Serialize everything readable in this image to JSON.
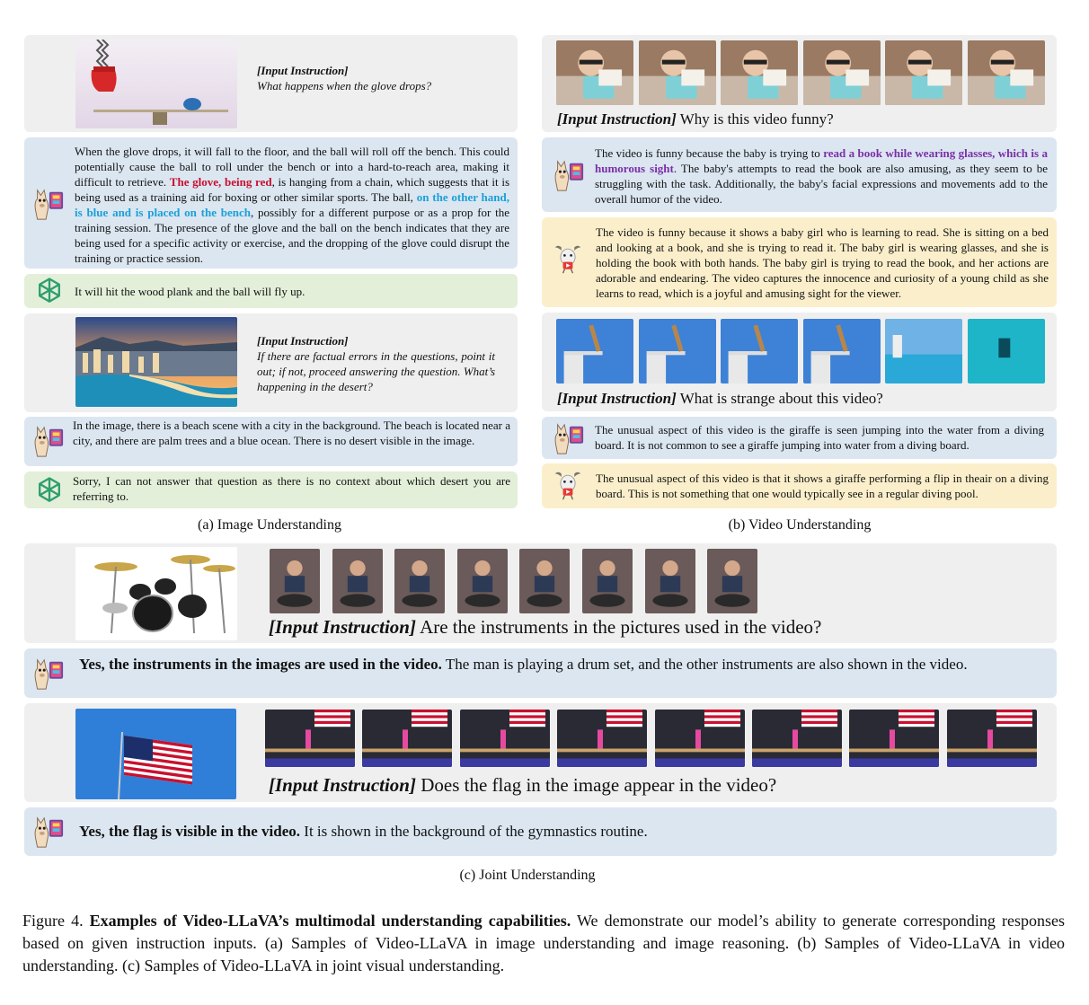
{
  "a": {
    "q1": {
      "label": "[Input Instruction]",
      "text": "What happens when the glove drops?"
    },
    "a1_llava": {
      "p1": "When the glove drops, it will fall to the floor, and the ball will roll off the bench. This could potentially cause the ball to roll under the bench or into a hard-to-reach area, making it difficult to retrieve. ",
      "h1": "The glove, being red",
      "p2": ", is hanging from a chain, which suggests that it is being used as a training aid for boxing or other similar sports. The ball, ",
      "h2": "on the other hand, is blue and is placed on the bench",
      "p3": ", possibly for a different purpose or as a prop for the training session. The presence of the glove and the ball on the bench indicates that they are being used for a specific activity or exercise, and the dropping of the glove could disrupt the training or practice session."
    },
    "a1_gpt": "It will hit the wood plank and the ball will fly up.",
    "q2": {
      "label": "[Input Instruction]",
      "text": "If there are factual errors in the questions, point it out; if not, proceed answering the question. What’s happening in the desert?"
    },
    "a2_llava": "In the image, there is a beach scene with a city in the background. The beach is located near a city, and there are palm trees and a blue ocean. There is no desert visible in the image.",
    "a2_gpt": "Sorry, I can not answer that question as there is no context about which desert you are referring to.",
    "caption": "(a) Image Understanding"
  },
  "b": {
    "q1": {
      "label": "[Input Instruction]",
      "text": " Why is this video funny?"
    },
    "a1_llava": {
      "p1": "The video is funny because the baby is trying to ",
      "h1": "read a book while wearing glasses, which is a humorous sight",
      "p2": ". The baby's attempts to read the book are also amusing, as they seem to be struggling with the task. Additionally, the baby's facial expressions and movements add to the overall humor of the video."
    },
    "a1_other": "The video is funny because it shows a baby girl who is learning to read. She is sitting on a bed and looking at a book, and she is trying to read it. The baby girl is wearing glasses, and she is holding the book with both hands. The baby girl is trying to read the book, and her actions are adorable and endearing. The video captures the innocence and curiosity of a young child as she learns to read, which is a joyful and amusing sight for the viewer.",
    "q2": {
      "label": "[Input Instruction]",
      "text": " What is strange about this video?"
    },
    "a2_llava": "The unusual aspect of this video is the giraffe is seen jumping into the water from a diving board. It is not common to see a giraffe jumping into water from a diving board.",
    "a2_other": "The unusual aspect of this video is that it shows a giraffe performing a flip in theair on a diving board. This is not something that one would typically see in a regular diving pool.",
    "caption": "(b) Video Understanding"
  },
  "c": {
    "q1": {
      "label": "[Input Instruction]",
      "text": " Are the instruments in the pictures used in the video?"
    },
    "a1": {
      "bold": "Yes, the instruments in the images are used in the video.",
      "rest": " The man is playing a drum set, and the other instruments are also shown in the video."
    },
    "q2": {
      "label": "[Input Instruction]",
      "text": " Does the flag in the image appear in the video?"
    },
    "a2": {
      "bold": "Yes, the flag is visible in the video.",
      "rest": " It is shown in the background of the gymnastics routine."
    },
    "caption": "(c) Joint Understanding"
  },
  "figure": {
    "label": "Figure 4.",
    "title": "Examples of Video-LLaVA’s multimodal understanding capabilities.",
    "body": " We demonstrate our model’s ability to generate corresponding responses based on given instruction inputs. (a) Samples of Video-LLaVA in image understanding and image reasoning. (b) Samples of Video-LLaVA in video understanding. (c) Samples of Video-LLaVA in joint visual understanding."
  },
  "icons": {
    "llava": "llama-icon",
    "gpt": "openai-icon",
    "other": "goat-icon"
  },
  "colors": {
    "gray_panel": "#efefef",
    "blue_panel": "#dbe6f1",
    "green_panel": "#e3efd9",
    "yellow_panel": "#fbefcb",
    "highlight_red": "#c8102e",
    "highlight_cyan": "#1aa0d8",
    "highlight_purple": "#7b2fa6"
  }
}
